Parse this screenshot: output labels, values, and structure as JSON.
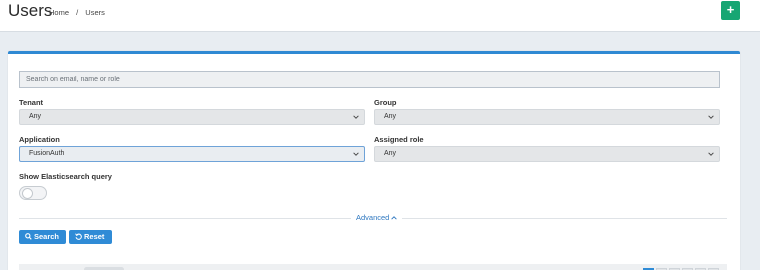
{
  "header": {
    "title": "Users",
    "breadcrumb": [
      "Home",
      "/",
      "Users"
    ],
    "add_label": "+"
  },
  "search": {
    "placeholder": "Search on email, name or role",
    "value": ""
  },
  "filters": {
    "tenant": {
      "label": "Tenant",
      "value": "Any"
    },
    "group": {
      "label": "Group",
      "value": "Any"
    },
    "application": {
      "label": "Application",
      "value": "FusionAuth"
    },
    "assigned_role": {
      "label": "Assigned role",
      "value": "Any"
    }
  },
  "elasticsearch": {
    "label": "Show Elasticsearch query",
    "enabled": false
  },
  "advanced_label": "Advanced",
  "buttons": {
    "search_label": "Search",
    "reset_label": "Reset"
  },
  "colors": {
    "accent": "#2f8bd6",
    "add_button": "#17a673"
  },
  "icons": [
    "plus-icon",
    "chevron-down-icon",
    "chevron-up-icon",
    "search-icon",
    "reset-icon"
  ]
}
